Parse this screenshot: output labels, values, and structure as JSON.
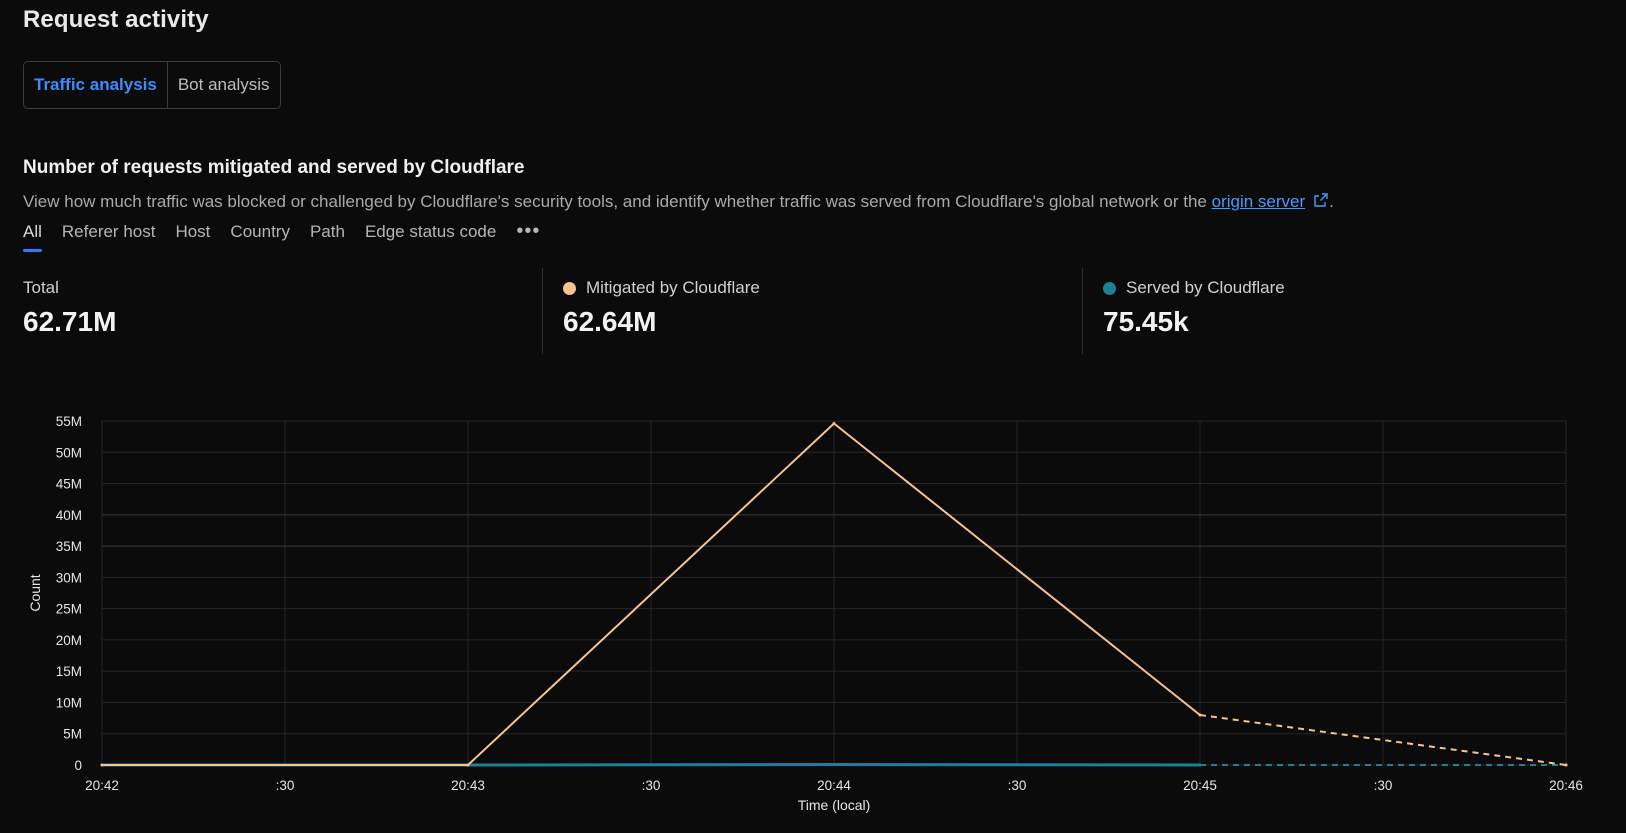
{
  "header": {
    "title": "Request activity"
  },
  "segments": [
    {
      "label": "Traffic analysis",
      "active": true
    },
    {
      "label": "Bot analysis",
      "active": false
    }
  ],
  "section": {
    "title": "Number of requests mitigated and served by Cloudflare",
    "description": "View how much traffic was blocked or challenged by Cloudflare's security tools, and identify whether traffic was served from Cloudflare's global network or the",
    "link_text": "origin server",
    "trailing": "."
  },
  "filter_tabs": [
    {
      "label": "All",
      "active": true
    },
    {
      "label": "Referer host"
    },
    {
      "label": "Host"
    },
    {
      "label": "Country"
    },
    {
      "label": "Path"
    },
    {
      "label": "Edge status code"
    }
  ],
  "more_label": "•••",
  "stats": [
    {
      "label": "Total",
      "value": "62.71M"
    },
    {
      "label": "Mitigated by Cloudflare",
      "value": "62.64M",
      "color": "#f5c291"
    },
    {
      "label": "Served by Cloudflare",
      "value": "75.45k",
      "color": "#1f7e98"
    }
  ],
  "colors": {
    "accent": "#2f7cf6",
    "link": "#4b98ff",
    "mitigated": "#f5c291",
    "served": "#1f7e98"
  },
  "chart_data": {
    "type": "line",
    "x": [
      "20:42:00",
      "20:42:30",
      "20:43:00",
      "20:43:30",
      "20:44:00",
      "20:44:30",
      "20:45:00",
      "20:45:30",
      "20:46:00"
    ],
    "x_tick_labels": [
      "20:42",
      ":30",
      "20:43",
      ":30",
      "20:44",
      ":30",
      "20:45",
      ":30",
      "20:46"
    ],
    "ylabel": "Count",
    "xlabel": "Time (local)",
    "ylim": [
      0,
      55000000
    ],
    "y_tick_labels": [
      "0",
      "5M",
      "10M",
      "15M",
      "20M",
      "25M",
      "30M",
      "35M",
      "40M",
      "45M",
      "50M",
      "55M"
    ],
    "grid": true,
    "series": [
      {
        "name": "Mitigated by Cloudflare",
        "color": "#f5c291",
        "points": [
          [
            "20:42:00",
            0
          ],
          [
            "20:43:00",
            0
          ],
          [
            "20:44:00",
            54600000
          ],
          [
            "20:45:00",
            8000000
          ],
          [
            "20:46:00",
            0
          ]
        ],
        "dashed_from": "20:45:00"
      },
      {
        "name": "Served by Cloudflare",
        "color": "#1f7e98",
        "points": [
          [
            "20:42:00",
            0
          ],
          [
            "20:43:00",
            0
          ],
          [
            "20:44:00",
            75450
          ],
          [
            "20:45:00",
            0
          ],
          [
            "20:46:00",
            0
          ]
        ],
        "dashed_from": "20:45:00"
      }
    ]
  }
}
